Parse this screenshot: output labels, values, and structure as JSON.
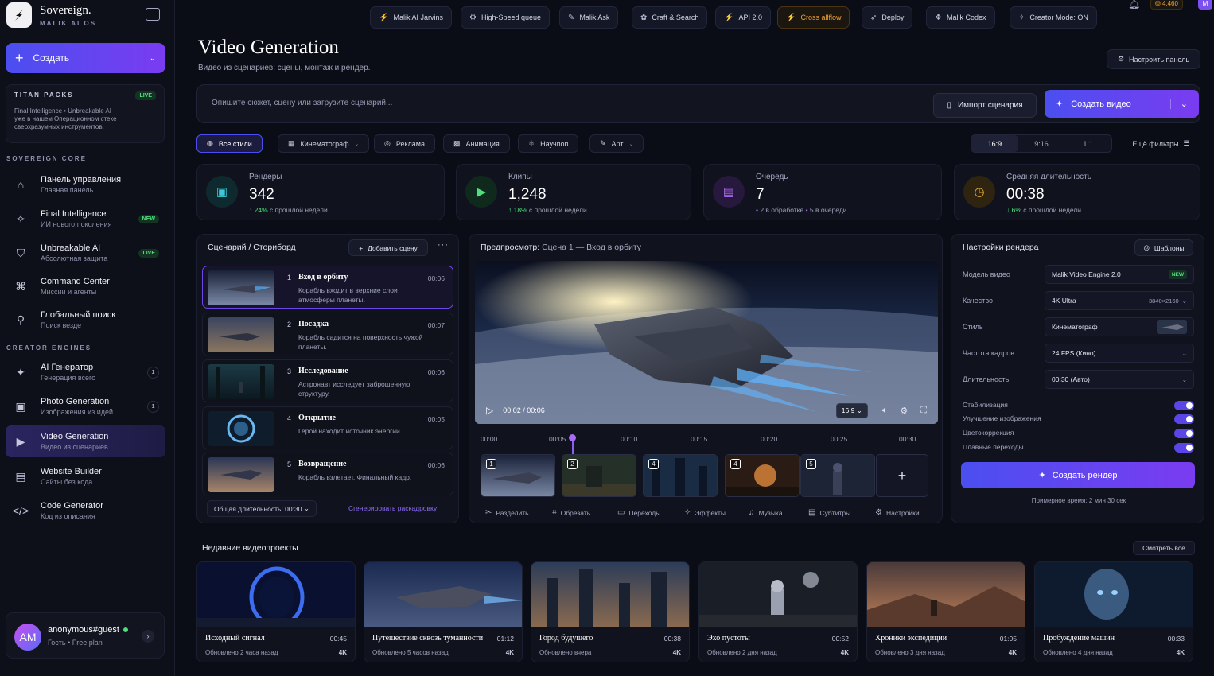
{
  "brand": {
    "name": "Sovereign.",
    "sub": "MALIK AI OS"
  },
  "sidebar": {
    "create_label": "Создать",
    "titan": {
      "title": "TITAN PACKS",
      "badge": "LIVE",
      "desc_line1": "Final Intelligence • Unbreakable AI",
      "desc_line2": "уже в нашем Операционном стеке",
      "desc_line3": "сверхразумных инструментов."
    },
    "sec_core": "SOVEREIGN CORE",
    "sec_creator": "CREATOR ENGINES",
    "items": [
      {
        "label": "Панель управления",
        "sub": "Главная панель",
        "icon": "home-icon"
      },
      {
        "label": "Final Intelligence",
        "sub": "ИИ нового поколения",
        "badge": "NEW",
        "icon": "sparkle-icon"
      },
      {
        "label": "Unbreakable AI",
        "sub": "Абсолютная защита",
        "badge": "LIVE",
        "icon": "shield-icon"
      },
      {
        "label": "Command Center",
        "sub": "Миссии и агенты",
        "icon": "command-icon"
      },
      {
        "label": "Глобальный поиск",
        "sub": "Поиск везде",
        "icon": "search-icon"
      },
      {
        "label": "AI Генератор",
        "sub": "Генерация всего",
        "count": "1",
        "icon": "sparkle-icon"
      },
      {
        "label": "Photo Generation",
        "sub": "Изображения из идей",
        "count": "1",
        "icon": "image-icon"
      },
      {
        "label": "Video Generation",
        "sub": "Видео из сценариев",
        "icon": "video-icon"
      },
      {
        "label": "Website Builder",
        "sub": "Сайты без кода",
        "icon": "layout-icon"
      },
      {
        "label": "Code Generator",
        "sub": "Код из описания",
        "icon": "code-icon"
      }
    ],
    "user": {
      "initials": "AM",
      "name": "anonymous#guest",
      "plan": "Гость • Free plan"
    }
  },
  "topbar": {
    "chips": [
      "Malik AI Jarvins",
      "High-Speed queue",
      "Malik Ask",
      "Craft & Search",
      "API 2.0",
      "Cross allflow",
      "Deploy",
      "Malik Codex",
      "Creator Mode: ON"
    ],
    "credits": "4,460",
    "avatar": "M"
  },
  "header": {
    "title": "Video Generation",
    "subtitle": "Видео из сценариев: сцены, монтаж и рендер.",
    "configure": "Настроить панель"
  },
  "prompt": {
    "placeholder": "Опишите сюжет, сцену или загрузите сценарий...",
    "import": "Импорт сценария",
    "generate": "Создать видео"
  },
  "styles": [
    "Все стили",
    "Кинематограф",
    "Реклама",
    "Анимация",
    "Научпоп",
    "Арт"
  ],
  "ratios": [
    "16:9",
    "9:16",
    "1:1"
  ],
  "more_filters": "Ещё фильтры",
  "stats": [
    {
      "label": "Рендеры",
      "value": "342",
      "delta": "↑ 24%",
      "note": " с прошлой недели"
    },
    {
      "label": "Клипы",
      "value": "1,248",
      "delta": "↑ 18%",
      "note": " с прошлой недели"
    },
    {
      "label": "Очередь",
      "value": "7",
      "a": "2 в обработке",
      "b": "5 в очереди"
    },
    {
      "label": "Средняя длительность",
      "value": "00:38",
      "delta": "↓ 6%",
      "note": " с прошлой недели"
    }
  ],
  "storyboard": {
    "title": "Сценарий / Сториборд",
    "add": "Добавить сцену",
    "scenes": [
      {
        "n": "1",
        "title": "Вход в орбиту",
        "desc": "Корабль входит в верхние слои атмосферы планеты.",
        "dur": "00:06"
      },
      {
        "n": "2",
        "title": "Посадка",
        "desc": "Корабль садится на поверхность чужой планеты.",
        "dur": "00:07"
      },
      {
        "n": "3",
        "title": "Исследование",
        "desc": "Астронавт исследует заброшенную структуру.",
        "dur": "00:06"
      },
      {
        "n": "4",
        "title": "Открытие",
        "desc": "Герой находит источник энергии.",
        "dur": "00:05"
      },
      {
        "n": "5",
        "title": "Возвращение",
        "desc": "Корабль взлетает. Финальный кадр.",
        "dur": "00:06"
      }
    ],
    "total": "Общая длительность: 00:30",
    "gen": "Сгенерировать раскадровку"
  },
  "preview": {
    "label": "Предпросмотр:",
    "scene": "Сцена 1 — Вход в орбиту",
    "time": "00:02 / 00:06",
    "ratio": "16:9",
    "ticks": [
      "00:00",
      "00:05",
      "00:10",
      "00:15",
      "00:20",
      "00:25",
      "00:30"
    ],
    "clips": [
      "1",
      "2",
      "4",
      "4",
      "5"
    ],
    "tools": [
      "Разделить",
      "Обрезать",
      "Переходы",
      "Эффекты",
      "Музыка",
      "Субтитры",
      "Настройки"
    ]
  },
  "render": {
    "title": "Настройки рендера",
    "templates": "Шаблоны",
    "rows": [
      {
        "label": "Модель видео",
        "value": "Malik Video Engine 2.0",
        "badge": "NEW"
      },
      {
        "label": "Качество",
        "value": "4K Ultra",
        "extra": "3840×2160"
      },
      {
        "label": "Стиль",
        "value": "Кинематограф"
      },
      {
        "label": "Частота кадров",
        "value": "24 FPS (Кино)"
      },
      {
        "label": "Длительность",
        "value": "00:30 (Авто)"
      }
    ],
    "toggles": [
      "Стабилизация",
      "Улучшение изображения",
      "Цветокоррекция",
      "Плавные переходы"
    ],
    "button": "Создать рендер",
    "estimate": "Примерное время: 2 мин 30 сек"
  },
  "recent": {
    "title": "Недавние видеопроекты",
    "see_all": "Смотреть все",
    "items": [
      {
        "title": "Исходный сигнал",
        "dur": "00:45",
        "updated": "Обновлено 2 часа назад",
        "q": "4K"
      },
      {
        "title": "Путешествие сквозь туманности",
        "dur": "01:12",
        "updated": "Обновлено 5 часов назад",
        "q": "4K"
      },
      {
        "title": "Город будущего",
        "dur": "00:38",
        "updated": "Обновлено вчера",
        "q": "4K"
      },
      {
        "title": "Эхо пустоты",
        "dur": "00:52",
        "updated": "Обновлено 2 дня назад",
        "q": "4K"
      },
      {
        "title": "Хроники экспедиции",
        "dur": "01:05",
        "updated": "Обновлено 3 дня назад",
        "q": "4K"
      },
      {
        "title": "Пробуждение машин",
        "dur": "00:33",
        "updated": "Обновлено 4 дня назад",
        "q": "4K"
      }
    ]
  },
  "colors": {
    "accent": "#5b4ff0",
    "accent2": "#7a3cf0",
    "green": "#4ee07e",
    "orange": "#f0a135",
    "bg": "#0b0d16"
  }
}
